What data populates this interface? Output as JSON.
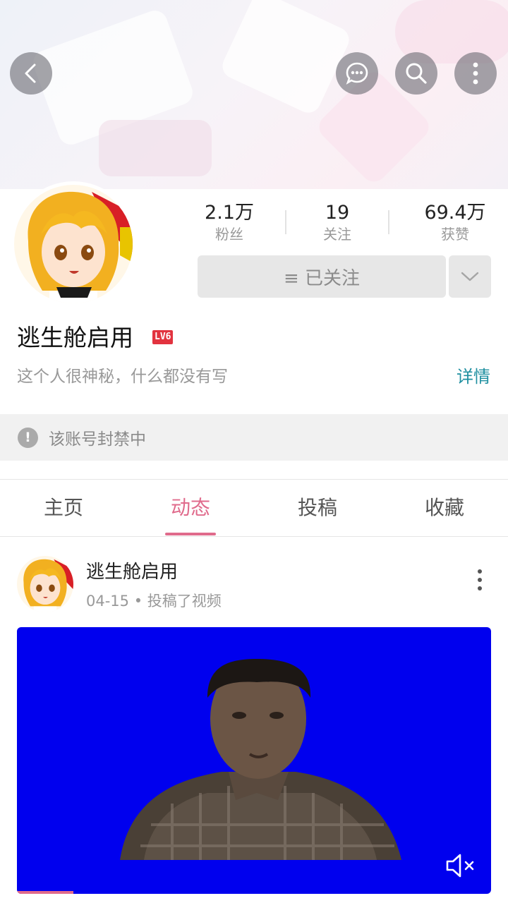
{
  "header": {
    "back_icon": "back-arrow-icon",
    "message_icon": "chat-bubble-icon",
    "search_icon": "search-icon",
    "more_icon": "more-vertical-icon"
  },
  "profile": {
    "stats": [
      {
        "value": "2.1万",
        "label": "粉丝"
      },
      {
        "value": "19",
        "label": "关注"
      },
      {
        "value": "69.4万",
        "label": "获赞"
      }
    ],
    "follow_button": "≡ 已关注",
    "username": "逃生舱启用",
    "level": "LV6",
    "bio": "这个人很神秘，什么都没有写",
    "detail_link": "详情"
  },
  "notice": {
    "text": "该账号封禁中"
  },
  "tabs": [
    {
      "label": "主页",
      "active": false
    },
    {
      "label": "动态",
      "active": true
    },
    {
      "label": "投稿",
      "active": false
    },
    {
      "label": "收藏",
      "active": false
    }
  ],
  "post": {
    "author": "逃生舱启用",
    "meta": "04-15 • 投稿了视频",
    "mute_icon": "muted-speaker-icon"
  },
  "colors": {
    "accent": "#e06b8c",
    "link": "#1e8fa0",
    "level_badge": "#e2333f",
    "video_bg": "#0000ee"
  }
}
